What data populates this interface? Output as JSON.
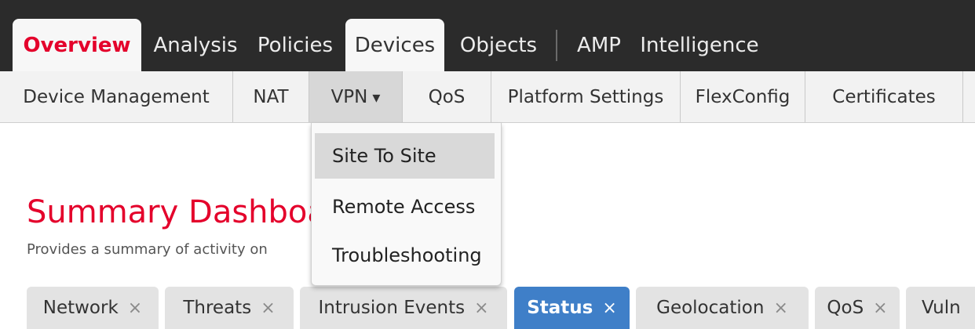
{
  "top_nav": {
    "tabs": [
      "Overview",
      "Analysis",
      "Policies",
      "Devices",
      "Objects",
      "AMP",
      "Intelligence"
    ]
  },
  "sub_nav": {
    "items": [
      "Device Management",
      "NAT",
      "VPN",
      "QoS",
      "Platform Settings",
      "FlexConfig",
      "Certificates"
    ],
    "vpn_caret": "▾"
  },
  "vpn_menu": {
    "items": [
      "Site To Site",
      "Remote Access",
      "Troubleshooting"
    ]
  },
  "page": {
    "title": "Summary Dashboard",
    "subtitle": "Provides a summary of activity on"
  },
  "dashboard_tabs": {
    "items": [
      "Network",
      "Threats",
      "Intrusion Events",
      "Status",
      "Geolocation",
      "QoS",
      "Vuln"
    ],
    "close_glyph": "×",
    "active": "Status"
  },
  "colors": {
    "accent_red": "#e4002b",
    "top_bar": "#2b2b2b",
    "active_tab_blue": "#3f7fc8"
  }
}
